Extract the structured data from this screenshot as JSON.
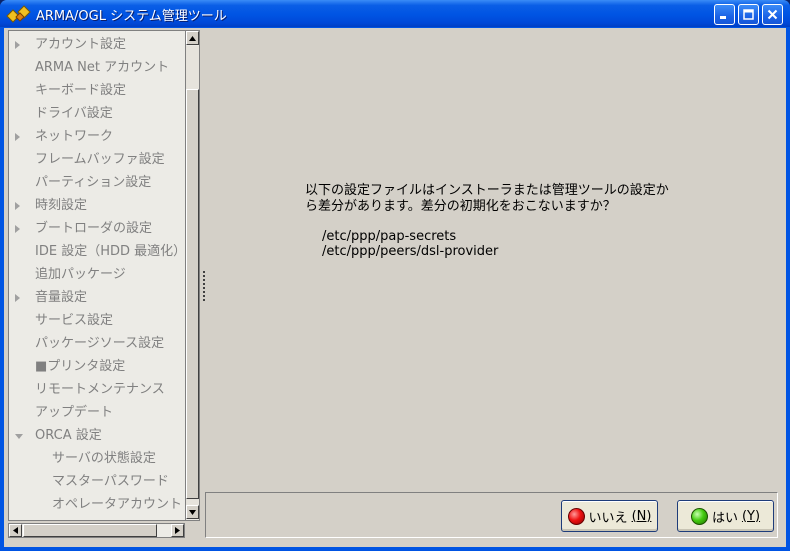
{
  "window": {
    "title": "ARMA/OGL システム管理ツール",
    "controls": {
      "minimize": "minimize-icon",
      "maximize": "maximize-icon",
      "close": "close-icon"
    }
  },
  "sidebar": {
    "items": [
      {
        "label": "アカウント設定",
        "expander": "collapsed",
        "level": 0
      },
      {
        "label": "ARMA Net アカウント",
        "expander": "none",
        "level": 0
      },
      {
        "label": "キーボード設定",
        "expander": "none",
        "level": 0
      },
      {
        "label": "ドライバ設定",
        "expander": "none",
        "level": 0
      },
      {
        "label": "ネットワーク",
        "expander": "collapsed",
        "level": 0
      },
      {
        "label": "フレームバッファ設定",
        "expander": "none",
        "level": 0
      },
      {
        "label": "パーティション設定",
        "expander": "none",
        "level": 0
      },
      {
        "label": "時刻設定",
        "expander": "collapsed",
        "level": 0
      },
      {
        "label": "ブートローダの設定",
        "expander": "collapsed",
        "level": 0
      },
      {
        "label": "IDE 設定（HDD 最適化）",
        "expander": "none",
        "level": 0
      },
      {
        "label": "追加パッケージ",
        "expander": "none",
        "level": 0
      },
      {
        "label": "音量設定",
        "expander": "collapsed",
        "level": 0
      },
      {
        "label": "サービス設定",
        "expander": "none",
        "level": 0
      },
      {
        "label": "パッケージソース設定",
        "expander": "none",
        "level": 0
      },
      {
        "label": "■プリンタ設定",
        "expander": "none",
        "level": 0
      },
      {
        "label": "リモートメンテナンス",
        "expander": "none",
        "level": 0
      },
      {
        "label": "アップデート",
        "expander": "none",
        "level": 0
      },
      {
        "label": "ORCA 設定",
        "expander": "expanded",
        "level": 0
      },
      {
        "label": "サーバの状態設定",
        "expander": "none",
        "level": 1
      },
      {
        "label": "マスターパスワード",
        "expander": "none",
        "level": 1
      },
      {
        "label": "オペレータアカウント",
        "expander": "none",
        "level": 1
      }
    ]
  },
  "main": {
    "message_line1": "以下の設定ファイルはインストーラまたは管理ツールの設定か",
    "message_line2": "ら差分があります。差分の初期化をおこないますか？",
    "files": [
      "/etc/ppp/pap-secrets",
      "/etc/ppp/peers/dsl-provider"
    ]
  },
  "buttons": {
    "no": {
      "label": "いいえ",
      "accel": "(N)"
    },
    "yes": {
      "label": "はい",
      "accel": "(Y)"
    }
  },
  "colors": {
    "titlebar": "#0054e3",
    "client_bg": "#d4d0c8",
    "sidebar_text": "#808080",
    "no_indicator": "#ee1010",
    "yes_indicator": "#44cc10"
  }
}
